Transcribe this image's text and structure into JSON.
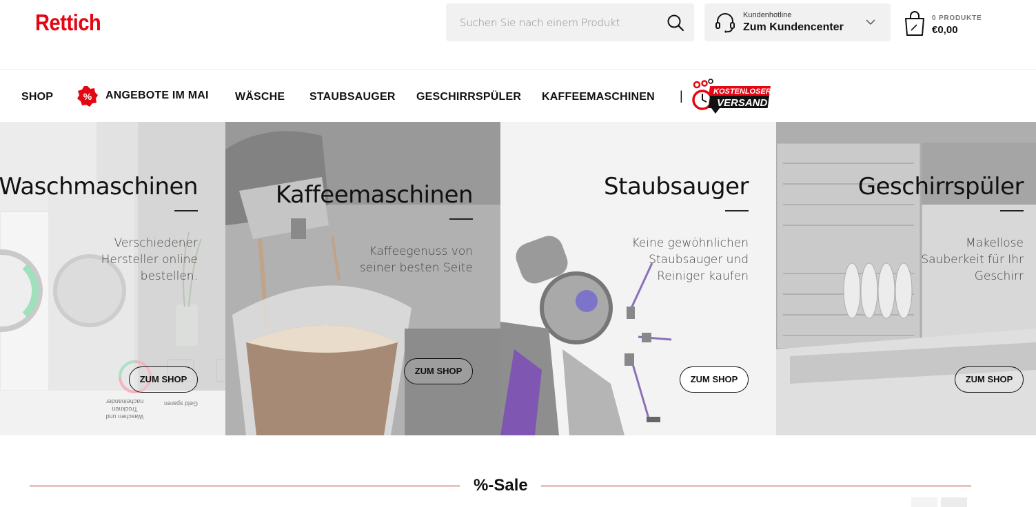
{
  "header": {
    "logo": "Rettich",
    "search_placeholder": "Suchen Sie nach einem Produkt",
    "hotline_small": "Kundenhotline",
    "hotline_big": "Zum Kundencenter",
    "cart_count": "0 PRODUKTE",
    "cart_total": "€0,00"
  },
  "nav": {
    "items": [
      "SHOP",
      "ANGEBOTE IM MAI",
      "WÄSCHE",
      "STAUBSAUGER",
      "GESCHIRRSPÜLER",
      "KAFFEEMASCHINEN"
    ],
    "promo_badge": "%",
    "separator": "|",
    "versand_top": "KOSTENLOSER",
    "versand_bottom": "VERSAND"
  },
  "panels": [
    {
      "title": "Waschmaschinen",
      "desc_lines": [
        "Verschiedener",
        "Hersteller online",
        "bestellen."
      ],
      "button": "ZUM SHOP"
    },
    {
      "title": "Kaffeemaschinen",
      "desc_lines": [
        "Kaffeegenuss von",
        "seiner besten Seite"
      ],
      "button": "ZUM SHOP"
    },
    {
      "title": "Staubsauger",
      "desc_lines": [
        "Keine gewöhnlichen",
        "Staubsauger und",
        "Reiniger kaufen"
      ],
      "button": "ZUM SHOP"
    },
    {
      "title": "Geschirrspüler",
      "desc_lines": [
        "Makellose",
        "Sauberkeit für Ihr",
        "Geschirr"
      ],
      "button": "ZUM SHOP"
    }
  ],
  "washer_captions": [
    "Waschen und Trocknen",
    "nacheinander",
    "Geld sparen"
  ],
  "sale": {
    "title": "%-Sale"
  },
  "colors": {
    "brand": "#e30613",
    "sale_line": "#b01a1a"
  }
}
